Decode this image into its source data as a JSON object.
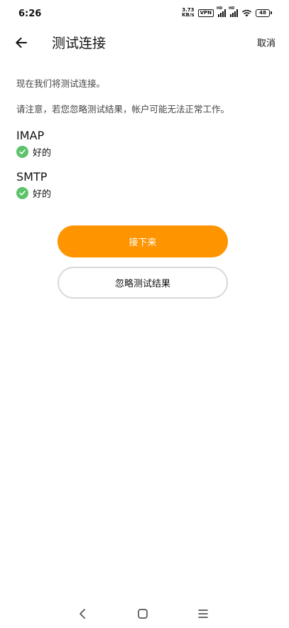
{
  "status_bar": {
    "time": "6:26",
    "net_speed_value": "3.73",
    "net_speed_unit": "KB/s",
    "vpn_label": "VPN",
    "signal_1_label": "HD",
    "signal_2_label": "HD",
    "battery_level": "48"
  },
  "app_bar": {
    "title": "测试连接",
    "cancel_label": "取消"
  },
  "content": {
    "intro": "现在我们将测试连接。",
    "warning": "请注意，若您忽略测试结果，帐户可能无法正常工作。",
    "protocols": [
      {
        "name": "IMAP",
        "status": "好的"
      },
      {
        "name": "SMTP",
        "status": "好的"
      }
    ]
  },
  "buttons": {
    "next_label": "接下来",
    "ignore_label": "忽略测试结果"
  },
  "colors": {
    "accent": "#fe9400",
    "success": "#5cc36a"
  }
}
